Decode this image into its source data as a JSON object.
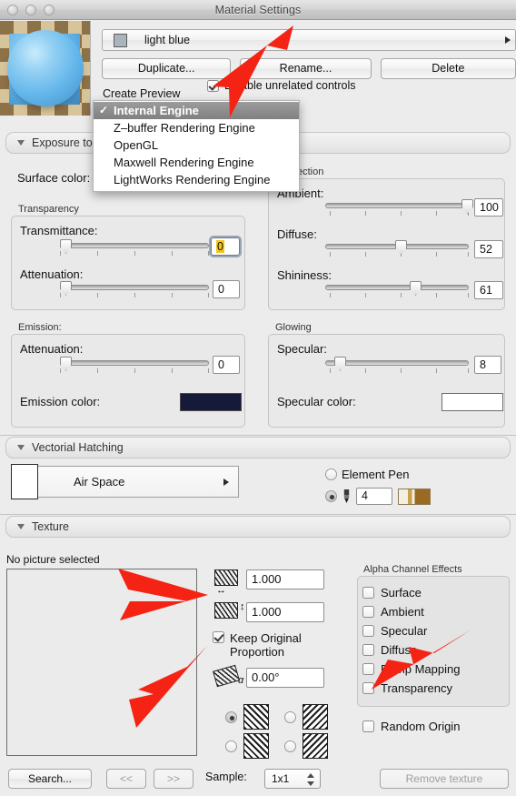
{
  "window": {
    "title": "Material Settings",
    "traffic_lights": [
      "close",
      "minimize",
      "zoom"
    ]
  },
  "material": {
    "name": "light blue",
    "swatch_color": "#a9b4bd",
    "buttons": {
      "duplicate": "Duplicate...",
      "rename": "Rename...",
      "delete": "Delete"
    },
    "create_preview_label": "Create Preview",
    "disable_unrelated": {
      "label": "Disable unrelated controls",
      "checked": true
    }
  },
  "engine_menu": {
    "open": true,
    "items": [
      {
        "label": "Internal Engine",
        "checked": true
      },
      {
        "label": "Z–buffer Rendering Engine",
        "checked": false
      },
      {
        "label": "OpenGL",
        "checked": false
      },
      {
        "label": "Maxwell Rendering Engine",
        "checked": false
      },
      {
        "label": "LightWorks Rendering Engine",
        "checked": false
      }
    ]
  },
  "exposure_section": {
    "header": "Exposure to",
    "expanded": true,
    "surface_color_label": "Surface color:",
    "transparency": {
      "group_label": "Transparency",
      "sliders": [
        {
          "label": "Transmittance:",
          "value": "0",
          "percent": 3,
          "focused": true
        },
        {
          "label": "Attenuation:",
          "value": "0",
          "percent": 3,
          "focused": false
        }
      ]
    },
    "reflection": {
      "group_label": "ection",
      "sliders": [
        {
          "label": "Ambient:",
          "value": "100",
          "percent": 100
        },
        {
          "label": "Diffuse:",
          "value": "52",
          "percent": 52
        },
        {
          "label": "Shininess:",
          "value": "61",
          "percent": 61
        }
      ]
    },
    "emission": {
      "group_label": "Emission:",
      "slider": {
        "label": "Attenuation:",
        "value": "0",
        "percent": 3
      },
      "color_label": "Emission color:",
      "color_value": "#15193a"
    },
    "glowing": {
      "group_label": "Glowing",
      "slider": {
        "label": "Specular:",
        "value": "8",
        "percent": 8
      },
      "color_label": "Specular color:",
      "color_value": "#ffffff"
    }
  },
  "hatching_section": {
    "header": "Vectorial Hatching",
    "expanded": true,
    "pattern": "Air Space",
    "element_pen": {
      "label": "Element Pen",
      "selected": false
    },
    "custom_pen": {
      "selected": true,
      "width": "4"
    }
  },
  "texture_section": {
    "header": "Texture",
    "expanded": true,
    "no_picture_label": "No picture selected",
    "width_value": "1.000",
    "height_value": "1.000",
    "keep_original_proportion": {
      "label": "Keep Original Proportion",
      "checked": true
    },
    "angle_value": "0.00°",
    "tiling_options": [
      {
        "name": "mirror-both",
        "selected": true
      },
      {
        "name": "mirror-horizontal",
        "selected": false
      },
      {
        "name": "mirror-vertical",
        "selected": false
      },
      {
        "name": "no-mirror",
        "selected": false
      }
    ],
    "alpha_channel": {
      "group_label": "Alpha Channel Effects",
      "items": [
        {
          "label": "Surface",
          "checked": false
        },
        {
          "label": "Ambient",
          "checked": false
        },
        {
          "label": "Specular",
          "checked": false
        },
        {
          "label": "Diffuse",
          "checked": false
        },
        {
          "label": "Bump Mapping",
          "checked": false
        },
        {
          "label": "Transparency",
          "checked": false
        }
      ]
    },
    "random_origin": {
      "label": "Random Origin",
      "checked": false
    }
  },
  "bottom_bar": {
    "search": "Search...",
    "prev": "<<",
    "next": ">>",
    "sample_label": "Sample:",
    "sample_value": "1x1",
    "remove_texture": "Remove texture"
  },
  "annotations": {
    "color": "#f42314",
    "arrows": [
      "arrow-to-engine-menu",
      "arrow-to-texture-size",
      "arrow-to-keep-proportion",
      "arrow-to-alpha-transparency"
    ]
  }
}
